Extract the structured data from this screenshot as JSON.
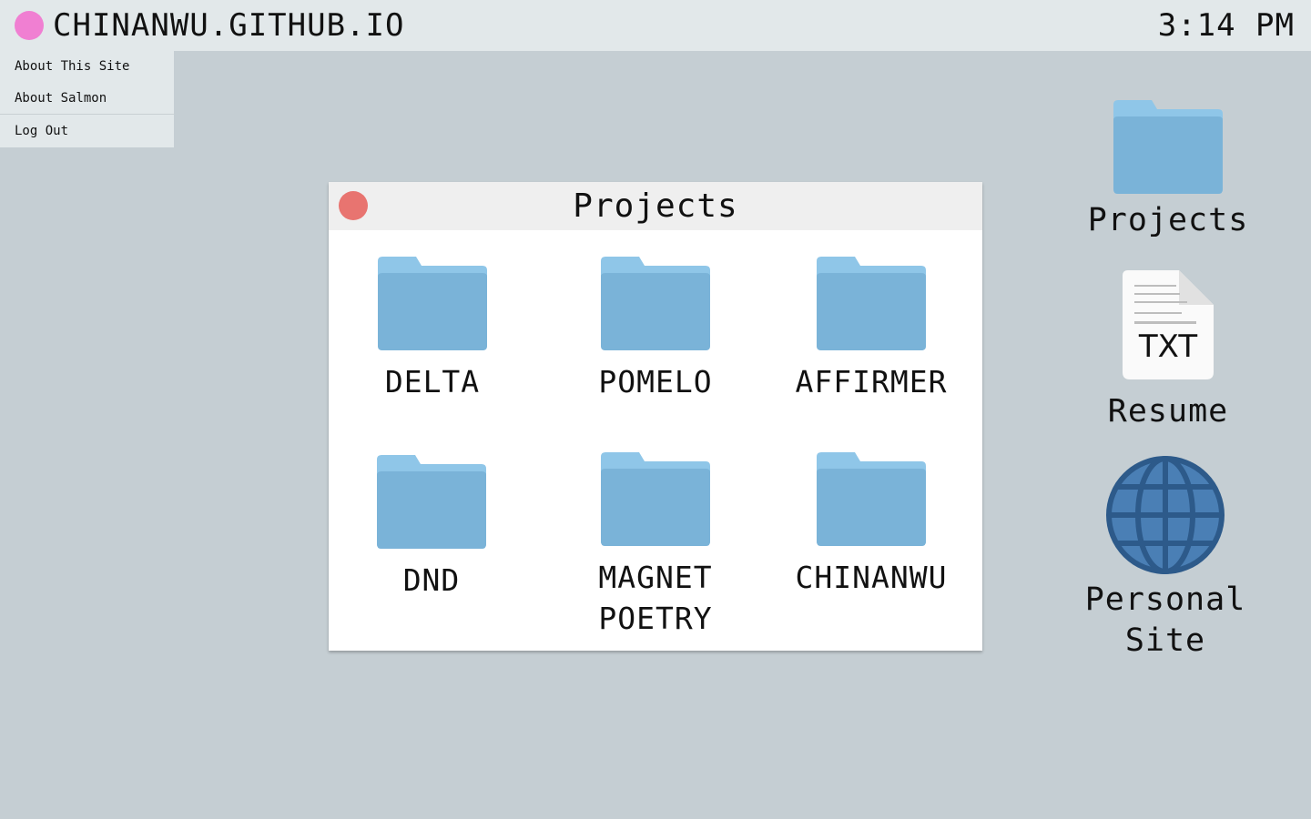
{
  "menubar": {
    "site_title": "CHINANWU.GITHUB.IO",
    "clock": "3:14 PM",
    "accent_color": "#f07fd2"
  },
  "dropdown": {
    "items": [
      {
        "label": "About This Site"
      },
      {
        "label": "About Salmon"
      },
      {
        "label": "Log Out"
      }
    ]
  },
  "window": {
    "title": "Projects",
    "close_color": "#e87470",
    "folders": [
      {
        "label": "DELTA",
        "icon": "folder-icon"
      },
      {
        "label": "POMELO",
        "icon": "folder-icon"
      },
      {
        "label": "AFFIRMER",
        "icon": "folder-icon"
      },
      {
        "label": "DND",
        "icon": "folder-icon"
      },
      {
        "label": "MAGNET\nPOETRY",
        "icon": "folder-icon"
      },
      {
        "label": "CHINANWU",
        "icon": "folder-icon"
      }
    ]
  },
  "desktop": {
    "icons": [
      {
        "label": "Projects",
        "icon": "folder-icon"
      },
      {
        "label": "Resume",
        "icon": "txt-file-icon",
        "badge": "TXT"
      },
      {
        "label": "Personal\nSite",
        "icon": "globe-icon"
      }
    ]
  },
  "colors": {
    "desktop_bg": "#c5ced3",
    "folder": "#7ab3d8",
    "folder_tab": "#8fc6e8",
    "globe": "#4a7fb5"
  }
}
